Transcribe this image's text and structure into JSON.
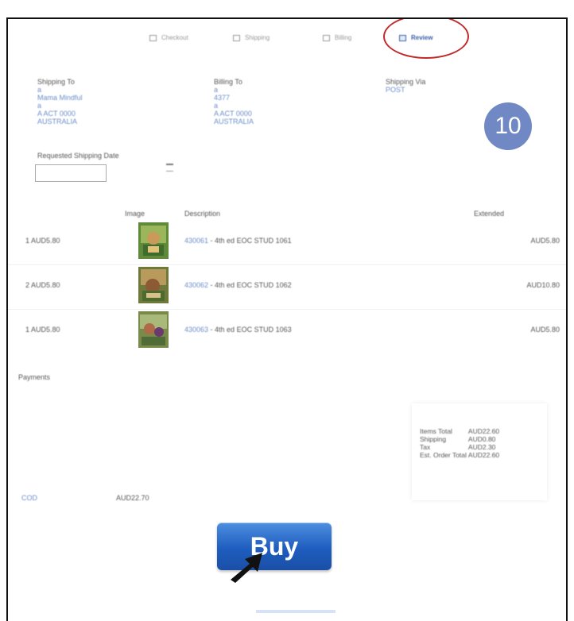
{
  "steps": [
    {
      "label": "Checkout",
      "icon": "home-icon"
    },
    {
      "label": "Shipping",
      "icon": "truck-icon"
    },
    {
      "label": "Billing",
      "icon": "card-icon"
    },
    {
      "label": "Review",
      "icon": "review-icon",
      "active": true
    }
  ],
  "shipping_to": {
    "title": "Shipping To",
    "lines": [
      "a",
      "Mama Mindful",
      "a",
      "A ACT 0000",
      "AUSTRALIA"
    ]
  },
  "billing_to": {
    "title": "Billing To",
    "lines": [
      "a",
      "4377",
      "a",
      "A ACT 0000",
      "AUSTRALIA"
    ]
  },
  "shipping_via": {
    "title": "Shipping Via",
    "value": "POST"
  },
  "step_badge": "10",
  "requested_date": {
    "label": "Requested Shipping Date",
    "value": ""
  },
  "table": {
    "headers": {
      "image": "Image",
      "description": "Description",
      "extended": "Extended"
    },
    "rows": [
      {
        "qty_price": "1 AUD5.80",
        "code": "430061",
        "desc": " - 4th ed EOC STUD 1061",
        "extended": "AUD5.80"
      },
      {
        "qty_price": "2 AUD5.80",
        "code": "430062",
        "desc": " - 4th ed EOC STUD 1062",
        "extended": "AUD10.80"
      },
      {
        "qty_price": "1 AUD5.80",
        "code": "430063",
        "desc": " - 4th ed EOC STUD 1063",
        "extended": "AUD5.80"
      }
    ]
  },
  "payments_label": "Payments",
  "totals": {
    "rows": [
      {
        "label": "Items Total",
        "value": "AUD22.60"
      },
      {
        "label": "Shipping",
        "value": "AUD0.80"
      },
      {
        "label": "Tax",
        "value": "AUD2.30"
      },
      {
        "label": "Est. Order Total",
        "value": "AUD22.60"
      }
    ]
  },
  "payment_method": {
    "name": "COD",
    "amount": "AUD22.70"
  },
  "buy_label": "Buy",
  "colors": {
    "accent": "#3b5fa8",
    "link": "#6b8ec9",
    "badge": "#7089c4",
    "circle": "#c02a2a",
    "buy": "#1f5dbf"
  }
}
